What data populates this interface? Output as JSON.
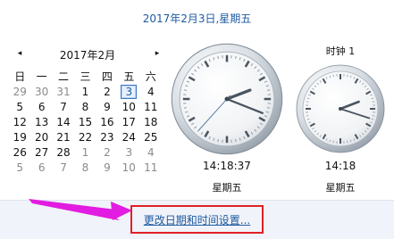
{
  "header": {
    "full_date": "2017年2月3日,星期五"
  },
  "calendar": {
    "prev_icon": "◂",
    "next_icon": "▸",
    "month_label": "2017年2月",
    "weekdays": [
      "日",
      "一",
      "二",
      "三",
      "四",
      "五",
      "六"
    ],
    "weeks": [
      [
        "29",
        "30",
        "31",
        "1",
        "2",
        "3",
        "4"
      ],
      [
        "5",
        "6",
        "7",
        "8",
        "9",
        "10",
        "11"
      ],
      [
        "12",
        "13",
        "14",
        "15",
        "16",
        "17",
        "18"
      ],
      [
        "19",
        "20",
        "21",
        "22",
        "23",
        "24",
        "25"
      ],
      [
        "26",
        "27",
        "28",
        "1",
        "2",
        "3",
        "4"
      ],
      [
        "5",
        "6",
        "7",
        "8",
        "9",
        "10",
        "11"
      ]
    ],
    "selected_day": "3"
  },
  "clocks": {
    "main": {
      "time": "14:18:37",
      "day": "星期五",
      "hour": 14,
      "minute": 18,
      "second": 37
    },
    "second": {
      "name": "时钟 1",
      "time": "14:18",
      "day": "星期五",
      "hour": 14,
      "minute": 18
    }
  },
  "footer": {
    "settings_link": "更改日期和时间设置..."
  },
  "colors": {
    "accent": "#1e5aa0",
    "highlight_box": "#e02026",
    "annotation_arrow": "#e21ce0",
    "footer_bg": "#f0f3f9"
  }
}
